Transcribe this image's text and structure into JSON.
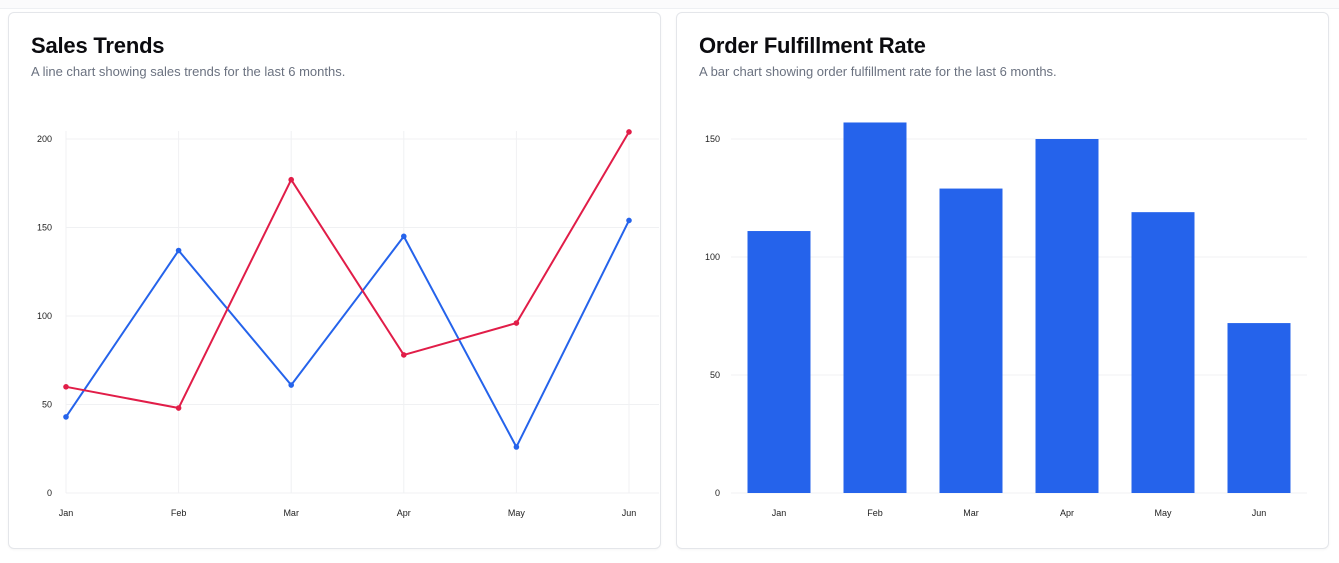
{
  "chart_data": [
    {
      "type": "line",
      "title": "Sales Trends",
      "subtitle": "A line chart showing sales trends for the last 6 months.",
      "categories": [
        "Jan",
        "Feb",
        "Mar",
        "Apr",
        "May",
        "Jun"
      ],
      "series": [
        {
          "color": "#2563eb",
          "values": [
            43,
            137,
            61,
            145,
            26,
            154
          ]
        },
        {
          "color": "#e11d48",
          "values": [
            60,
            48,
            177,
            78,
            96,
            204
          ]
        }
      ],
      "ylim": [
        0,
        200
      ],
      "yticks": [
        0,
        50,
        100,
        150,
        200
      ],
      "grid": true
    },
    {
      "type": "bar",
      "title": "Order Fulfillment Rate",
      "subtitle": "A bar chart showing order fulfillment rate for the last 6 months.",
      "categories": [
        "Jan",
        "Feb",
        "Mar",
        "Apr",
        "May",
        "Jun"
      ],
      "values": [
        111,
        157,
        129,
        150,
        119,
        72
      ],
      "color": "#2563eb",
      "ylim": [
        0,
        150
      ],
      "yticks": [
        0,
        50,
        100,
        150
      ],
      "grid": true
    }
  ]
}
